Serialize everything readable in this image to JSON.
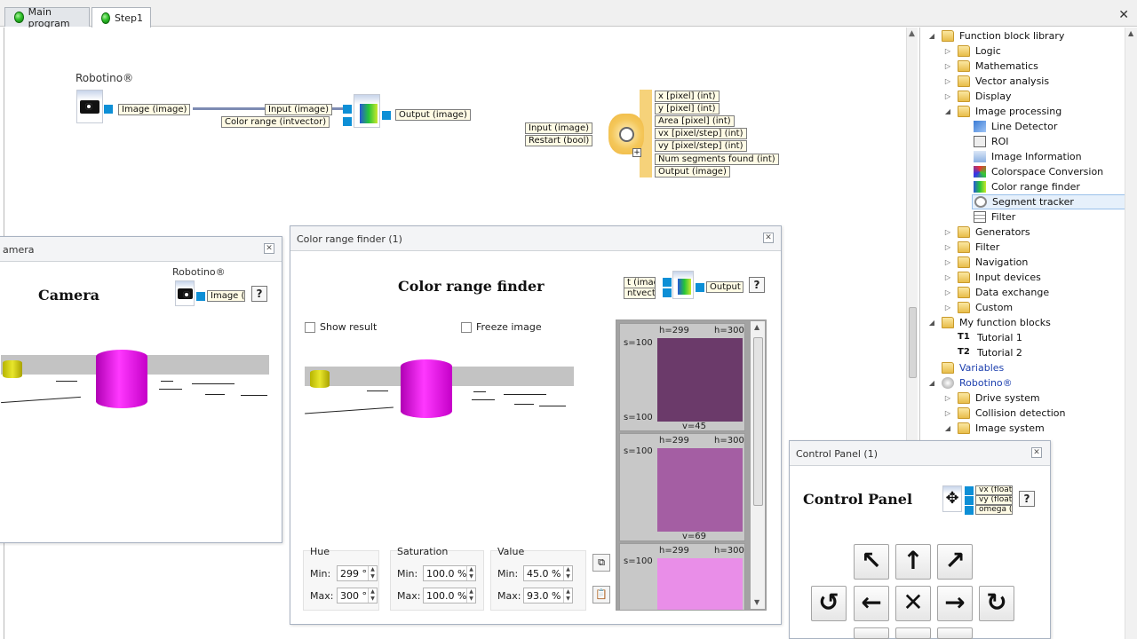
{
  "tabs": [
    {
      "label": "Main program"
    },
    {
      "label": "Step1"
    }
  ],
  "diagram": {
    "camera_block": {
      "title": "Robotino®",
      "output": "Image (image)"
    },
    "crf_block": {
      "inputs": [
        "Input (image)",
        "Color range (intvector)"
      ],
      "output": "Output (image)"
    },
    "segment_tracker": {
      "inputs": [
        "Input (image)",
        "Restart (bool)"
      ],
      "outputs": [
        "x [pixel] (int)",
        "y [pixel] (int)",
        "Area [pixel] (int)",
        "vx [pixel/step] (int)",
        "vy [pixel/step] (int)",
        "Num segments found (int)",
        "Output (image)"
      ]
    }
  },
  "camera_window": {
    "title": "amera",
    "heading": "Camera",
    "block_title": "Robotino®",
    "port": "Image (in",
    "help": "?"
  },
  "crf_window": {
    "title": "Color range finder (1)",
    "heading": "Color range finder",
    "mini_ports": [
      "t (image)",
      "ntvector)"
    ],
    "mini_out": "Output (i",
    "help": "?",
    "show_result": "Show result",
    "freeze_image": "Freeze image",
    "hue": {
      "label": "Hue",
      "min_label": "Min:",
      "max_label": "Max:",
      "min": "299 °",
      "max": "300 °"
    },
    "saturation": {
      "label": "Saturation",
      "min_label": "Min:",
      "max_label": "Max:",
      "min": "100.0 %",
      "max": "100.0 %"
    },
    "value": {
      "label": "Value",
      "min_label": "Min:",
      "max_label": "Max:",
      "min": "45.0 %",
      "max": "93.0 %"
    },
    "swatches": [
      {
        "h_lo": "h=299",
        "h_hi": "h=300",
        "s_top": "s=100",
        "s_bottom": "s=100",
        "v": "v=45",
        "color": "#6b3a6a"
      },
      {
        "h_lo": "h=299",
        "h_hi": "h=300",
        "s_top": "s=100",
        "s_bottom": "",
        "v": "v=69",
        "color": "#a45ea3"
      },
      {
        "h_lo": "h=299",
        "h_hi": "h=300",
        "s_top": "s=100",
        "s_bottom": "",
        "v": "",
        "color": "#e98ee8"
      }
    ]
  },
  "control_panel": {
    "title": "Control Panel (1)",
    "heading": "Control Panel",
    "ports": [
      "vx (float)",
      "vy (float)",
      "omega (f"
    ],
    "help": "?",
    "buttons": {
      "up_left": "↖",
      "up": "↑",
      "up_right": "↗",
      "rotate_left": "↺",
      "left": "←",
      "stop": "✕",
      "right": "→",
      "rotate_right": "↻"
    }
  },
  "tree": {
    "items": [
      {
        "label": "Function block library"
      },
      {
        "label": "Logic"
      },
      {
        "label": "Mathematics"
      },
      {
        "label": "Vector analysis"
      },
      {
        "label": "Display"
      },
      {
        "label": "Image processing"
      },
      {
        "label": "Line Detector"
      },
      {
        "label": "ROI"
      },
      {
        "label": "Image Information"
      },
      {
        "label": "Colorspace Conversion"
      },
      {
        "label": "Color range finder"
      },
      {
        "label": "Segment tracker"
      },
      {
        "label": "Filter"
      },
      {
        "label": "Generators"
      },
      {
        "label": "Filter"
      },
      {
        "label": "Navigation"
      },
      {
        "label": "Input devices"
      },
      {
        "label": "Data exchange"
      },
      {
        "label": "Custom"
      },
      {
        "label": "My function blocks"
      },
      {
        "label": "Tutorial 1"
      },
      {
        "label": "Tutorial 2"
      },
      {
        "label": "Variables"
      },
      {
        "label": "Robotino®"
      },
      {
        "label": "Drive system"
      },
      {
        "label": "Collision detection"
      },
      {
        "label": "Image system"
      }
    ],
    "badges": [
      "T1",
      "T2"
    ]
  },
  "colors": {
    "port_blue": "#0d8fd6",
    "tracker_orange": "#f6d27a",
    "cylinder_magenta": "#e000e0"
  }
}
